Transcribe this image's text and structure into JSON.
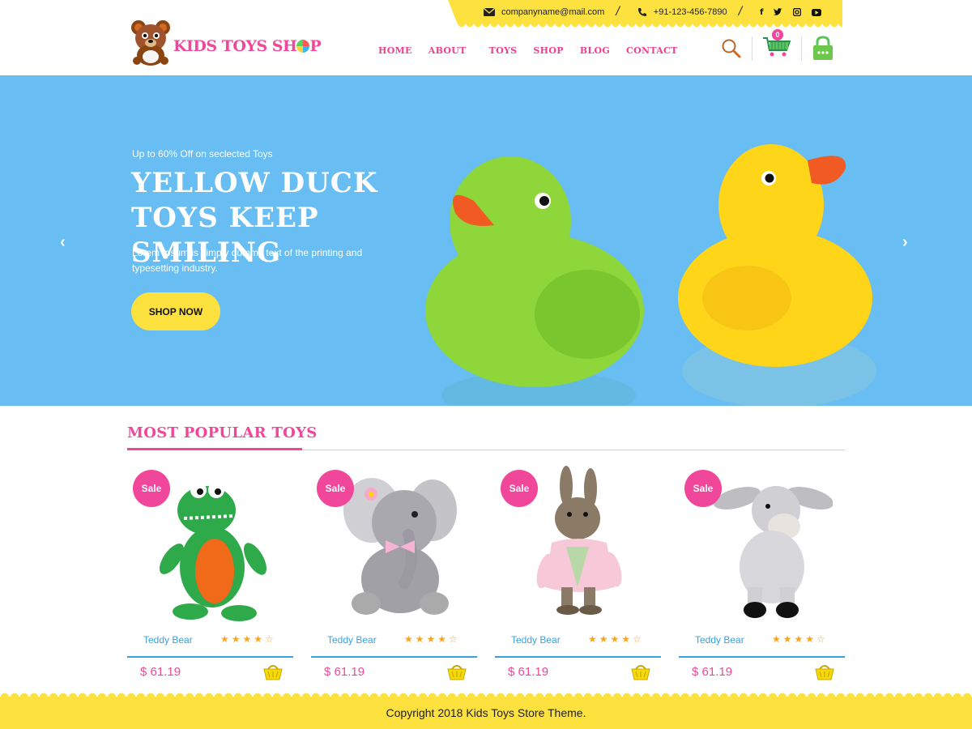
{
  "topbar": {
    "email": "companyname@mail.com",
    "phone": "+91-123-456-7890",
    "social": [
      "f",
      "t",
      "ig",
      "yt"
    ]
  },
  "brand": {
    "name": "KIDS TOYS SH",
    "name_tail": "P"
  },
  "nav": {
    "items": [
      "HOME",
      "ABOUT",
      "TOYS",
      "SHOP",
      "BLOG",
      "CONTACT"
    ]
  },
  "header": {
    "cart_count": "0",
    "icons": [
      "search-icon",
      "cart-icon",
      "lock-icon"
    ]
  },
  "hero": {
    "kicker": "Up to 60% Off on seclected Toys",
    "title_line1": "YELLOW DUCK",
    "title_line2": "TOYS KEEP SMILING",
    "description": "Lorem Ipsum is simply dummy text of the printing and typesetting industry.",
    "button": "SHOP NOW",
    "prev": "‹",
    "next": "›"
  },
  "popular": {
    "title": "MOST POPULAR TOYS",
    "products": [
      {
        "badge": "Sale",
        "name": "Teddy Bear",
        "price": "$ 61.19",
        "rating": 4,
        "stars": "★★★★☆"
      },
      {
        "badge": "Sale",
        "name": "Teddy Bear",
        "price": "$ 61.19",
        "rating": 4,
        "stars": "★★★★☆"
      },
      {
        "badge": "Sale",
        "name": "Teddy Bear",
        "price": "$ 61.19",
        "rating": 4,
        "stars": "★★★★☆"
      },
      {
        "badge": "Sale",
        "name": "Teddy Bear",
        "price": "$ 61.19",
        "rating": 4,
        "stars": "★★★★☆"
      }
    ]
  },
  "footer": {
    "copyright": "Copyright 2018 Kids Toys Store Theme."
  },
  "colors": {
    "pink": "#f0479b",
    "yellow": "#fde13f",
    "sky": "#68bdf2",
    "blue": "#3aa1e0"
  }
}
